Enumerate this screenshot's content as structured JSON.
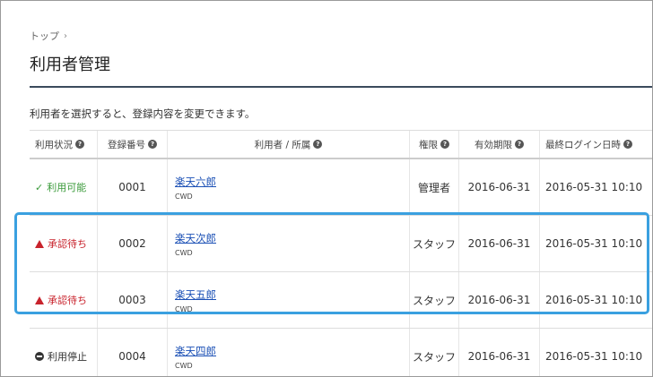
{
  "breadcrumb": {
    "top_label": "トップ",
    "separator": "›"
  },
  "page": {
    "title": "利用者管理",
    "description": "利用者を選択すると、登録内容を変更できます。"
  },
  "table": {
    "headers": [
      "利用状況",
      "登録番号",
      "利用者 / 所属",
      "権限",
      "有効期限",
      "最終ログイン日時"
    ],
    "rows": [
      {
        "status": "利用可能",
        "status_type": "ok",
        "number": "0001",
        "name": "楽天六郎",
        "org": "CWD",
        "role": "管理者",
        "expiry": "2016-06-31",
        "last_login": "2016-05-31 10:10"
      },
      {
        "status": "承認待ち",
        "status_type": "wait",
        "number": "0002",
        "name": "楽天次郎",
        "org": "CWD",
        "role": "スタッフ",
        "expiry": "2016-06-31",
        "last_login": "2016-05-31 10:10"
      },
      {
        "status": "承認待ち",
        "status_type": "wait",
        "number": "0003",
        "name": "楽天五郎",
        "org": "CWD",
        "role": "スタッフ",
        "expiry": "2016-06-31",
        "last_login": "2016-05-31 10:10"
      },
      {
        "status": "利用停止",
        "status_type": "stop",
        "number": "0004",
        "name": "楽天四郎",
        "org": "CWD",
        "role": "スタッフ",
        "expiry": "2016-06-31",
        "last_login": "2016-05-31 10:10"
      }
    ]
  },
  "colors": {
    "ok": "#3a9a3a",
    "wait": "#c8232c",
    "stop": "#333333",
    "link": "#1a4fb5",
    "highlight": "#3aa0e0",
    "title_rule": "#3b4a5c"
  },
  "icons": {
    "help": "question-circle-icon",
    "ok": "check-icon",
    "wait": "warning-triangle-icon",
    "stop": "minus-circle-icon"
  }
}
